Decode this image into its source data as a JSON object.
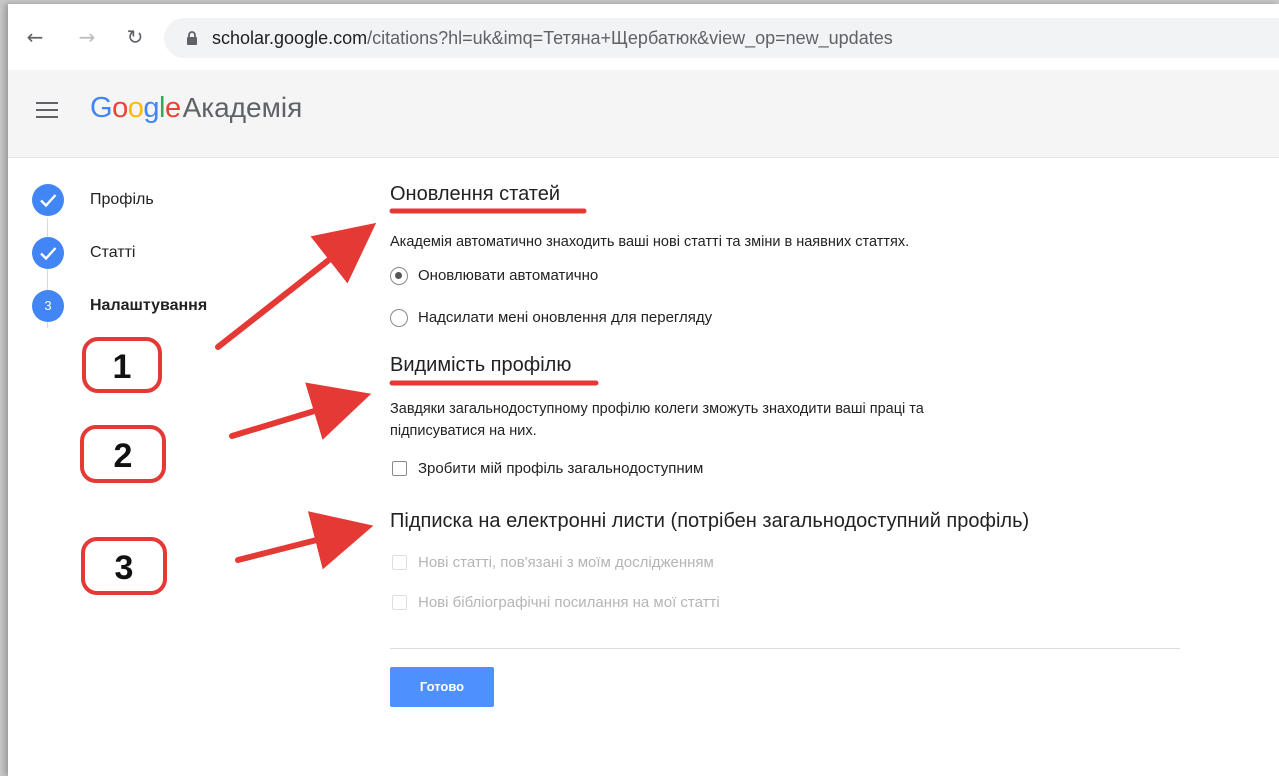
{
  "browser": {
    "back_icon": "arrow-left-icon",
    "forward_icon": "arrow-right-icon",
    "reload_icon": "reload-icon",
    "url_domain": "scholar.google.com",
    "url_path": "/citations?hl=uk&imq=Тетяна+Щербатюк&view_op=new_updates"
  },
  "header": {
    "logo_google": "Google",
    "logo_suffix": "Академія",
    "logo_colors": [
      "#4285f4",
      "#ea4335",
      "#fbbc05",
      "#4285f4",
      "#34a853",
      "#ea4335"
    ]
  },
  "stepper": {
    "steps": [
      {
        "label": "Профіль",
        "state": "done",
        "icon": "check-icon"
      },
      {
        "label": "Статті",
        "state": "done",
        "icon": "check-icon"
      },
      {
        "label": "Налаштування",
        "state": "active",
        "number": "3"
      }
    ]
  },
  "sections": {
    "updates": {
      "title": "Оновлення статей",
      "description": "Академія автоматично знаходить ваші нові статті та зміни в наявних статтях.",
      "options": [
        {
          "label": "Оновлювати автоматично",
          "checked": true
        },
        {
          "label": "Надсилати мені оновлення для перегляду",
          "checked": false
        }
      ]
    },
    "visibility": {
      "title": "Видимість профілю",
      "description_line1": "Завдяки загальнодоступному профілю колеги зможуть знаходити ваші праці та",
      "description_line2": "підписуватися на них.",
      "checkbox_label": "Зробити мій профіль загальнодоступним",
      "checked": false
    },
    "email": {
      "title": "Підписка на електронні листи (потрібен загальнодоступний профіль)",
      "options": [
        {
          "label": "Нові статті, пов'язані з моїм дослідженням",
          "disabled": true
        },
        {
          "label": "Нові бібліографічні посилання на мої статті",
          "disabled": true
        }
      ]
    }
  },
  "actions": {
    "done_label": "Готово"
  },
  "annotations": {
    "numbers": [
      "1",
      "2",
      "3"
    ],
    "color": "#e53935"
  },
  "colors": {
    "accent": "#4285f4",
    "button": "#4d90fe"
  }
}
